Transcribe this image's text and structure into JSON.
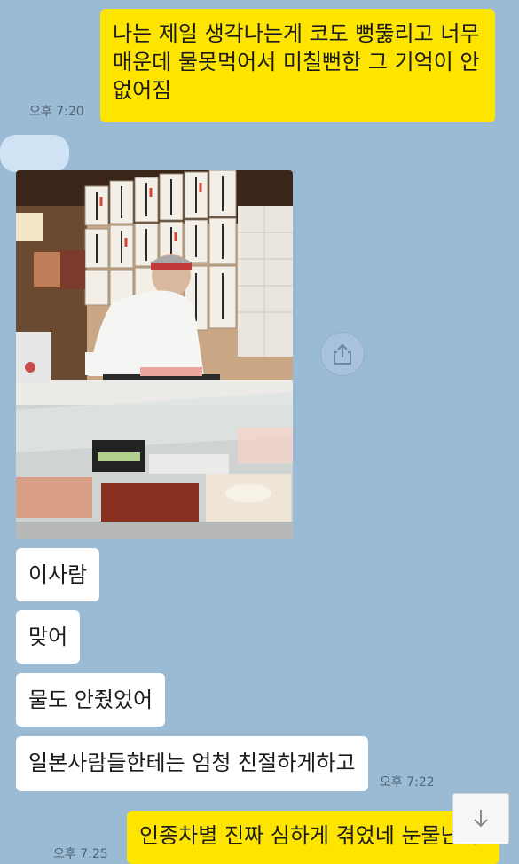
{
  "messages": {
    "m1": {
      "text": "나는 제일 생각나는게 코도 뻥뚫리고 너무 매운데 물못먹어서 미칠뻔한 그 기억이 안 없어짐",
      "time": "오후 7:20"
    },
    "m2": {
      "text": "이사람"
    },
    "m3": {
      "text": "맞어"
    },
    "m4": {
      "text": "물도 안줬었어"
    },
    "m5": {
      "text": "일본사람들한테는 엄청 친절하게하고",
      "time": "오후 7:22"
    },
    "m6": {
      "text": "인종차별 진짜 심하게 겪었네 눈물난다",
      "time": "오후 7:25"
    }
  },
  "photo": {
    "description": "sushi-chef-counter-photo"
  },
  "icons": {
    "share": "share-icon",
    "scroll_down": "arrow-down-icon"
  },
  "colors": {
    "background": "#9bbbd4",
    "outgoing_bubble": "#fee500",
    "incoming_bubble": "#ffffff"
  }
}
